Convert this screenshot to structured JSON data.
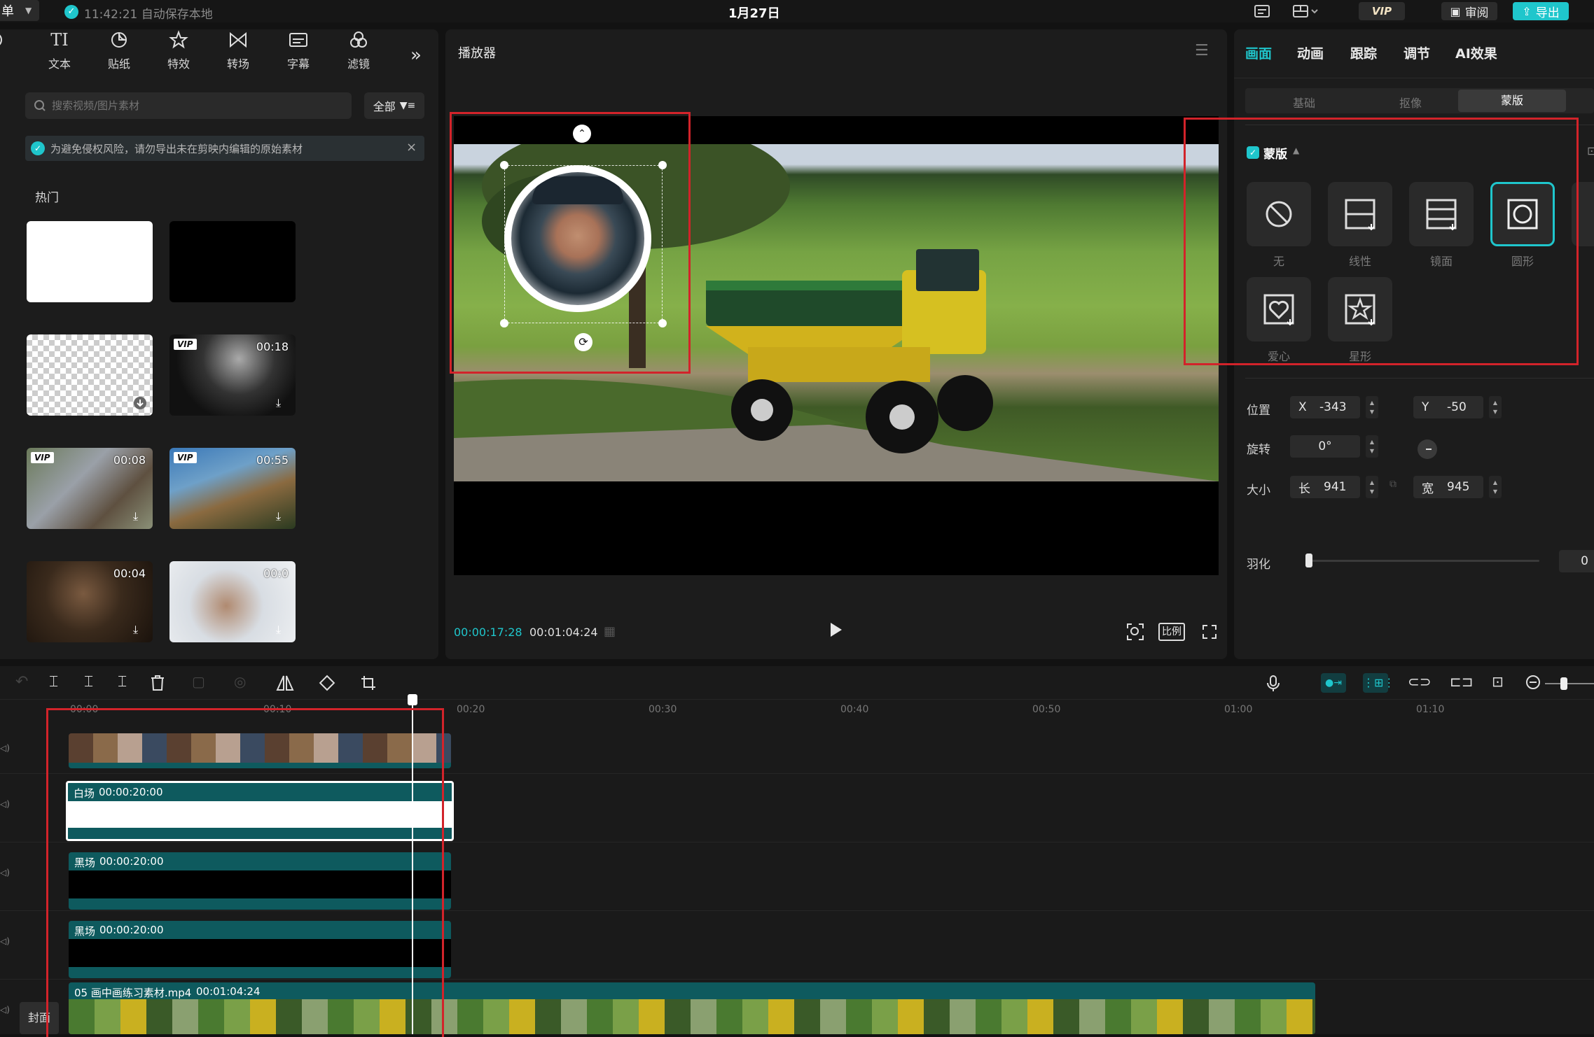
{
  "titlebar": {
    "menu_label": "单",
    "autosave": "11:42:21 自动保存本地",
    "project_title": "1月27日",
    "vip_label": "VIP",
    "review_label": "审阅",
    "export_label": "导出"
  },
  "left": {
    "tools": [
      {
        "label": "频",
        "icon": "audio-icon"
      },
      {
        "label": "文本",
        "icon": "text-icon"
      },
      {
        "label": "贴纸",
        "icon": "sticker-icon"
      },
      {
        "label": "特效",
        "icon": "effects-icon"
      },
      {
        "label": "转场",
        "icon": "transition-icon"
      },
      {
        "label": "字幕",
        "icon": "subtitle-icon"
      },
      {
        "label": "滤镜",
        "icon": "filter-icon"
      }
    ],
    "search_placeholder": "搜索视频/图片素材",
    "filter_label": "全部",
    "notice": "为避免侵权风险，请勿导出未在剪映内编辑的原始素材",
    "section_title": "热门",
    "thumbs": [
      {
        "duration": "",
        "vip": false
      },
      {
        "duration": "",
        "vip": false
      },
      {
        "duration": "",
        "vip": false
      },
      {
        "duration": "00:18",
        "vip": true
      },
      {
        "duration": "00:08",
        "vip": true
      },
      {
        "duration": "00:55",
        "vip": true
      },
      {
        "duration": "00:04",
        "vip": false
      },
      {
        "duration": "00:0",
        "vip": false
      }
    ]
  },
  "player": {
    "title": "播放器",
    "current_time": "00:00:17:28",
    "total_time": "00:01:04:24",
    "ratio_label": "比例"
  },
  "right": {
    "tabs": [
      "画面",
      "动画",
      "跟踪",
      "调节",
      "AI效果"
    ],
    "active_tab": "画面",
    "subtabs": [
      "基础",
      "抠像",
      "蒙版"
    ],
    "active_subtab": "蒙版",
    "mask_section_label": "蒙版",
    "masks": [
      "无",
      "线性",
      "镜面",
      "圆形",
      "爱心",
      "星形"
    ],
    "selected_mask": "圆形",
    "position_label": "位置",
    "x_label": "X",
    "x_value": "-343",
    "y_label": "Y",
    "y_value": "-50",
    "rotation_label": "旋转",
    "rotation_value": "0°",
    "size_label": "大小",
    "length_label": "长",
    "length_value": "941",
    "width_label": "宽",
    "width_value": "945",
    "feather_label": "羽化",
    "feather_value": "0",
    "feather_level": 0
  },
  "timeline": {
    "ruler": [
      "00:00",
      "00:10",
      "00:20",
      "00:30",
      "00:40",
      "00:50",
      "01:00",
      "01:10"
    ],
    "clips": [
      {
        "name": "白场",
        "duration": "00:00:20:00"
      },
      {
        "name": "黑场",
        "duration": "00:00:20:00"
      },
      {
        "name": "黑场",
        "duration": "00:00:20:00"
      }
    ],
    "main_clip_name": "05 画中画练习素材.mp4",
    "main_clip_duration": "00:01:04:24",
    "cover_label": "封面"
  },
  "colors": {
    "accent": "#1fc6cc",
    "clip_teal": "#0e5a5e",
    "highlight_red": "#d2232a"
  }
}
